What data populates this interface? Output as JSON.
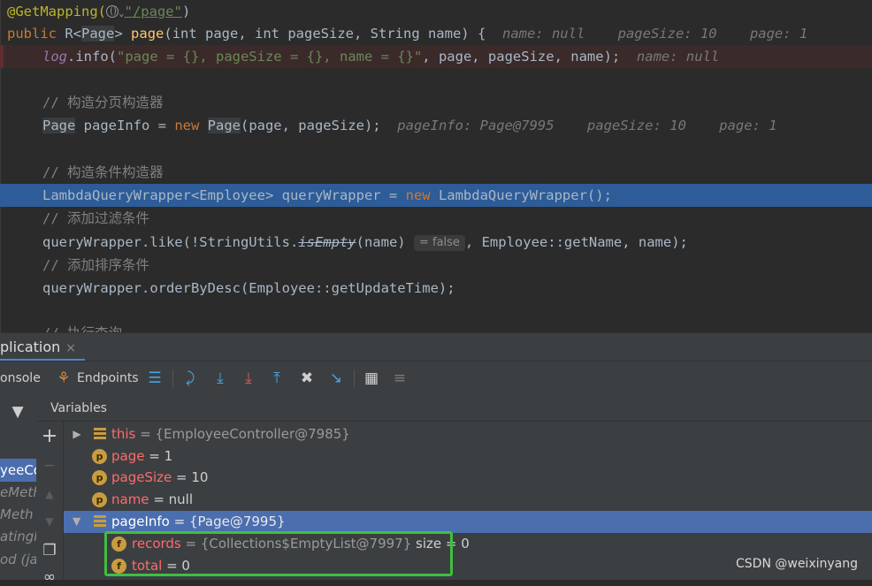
{
  "editor": {
    "lines": [
      {
        "kind": "annotation",
        "annotation": "@GetMapping(",
        "path": "\"/page\"",
        "close": ")"
      },
      {
        "kind": "signature",
        "public": "public",
        "r": "R<",
        "page_type": "Page",
        "gt": ">",
        "method": "page",
        "params": "(int page, int pageSize, String name) {",
        "hints": "name: null    pageSize: 10    page: 1"
      },
      {
        "kind": "log",
        "log": "log",
        "call": ".info(",
        "fmt": "\"page = {}, pageSize = {}, name = {}\"",
        "rest": ", page, pageSize, name);",
        "hint": "name: null"
      },
      {
        "kind": "comment",
        "text": "// 构造分页构造器"
      },
      {
        "kind": "pageinfo",
        "type": "Page",
        "a": " pageInfo = ",
        "new": "new",
        "b": " ",
        "type2": "Page",
        "c": "(page, pageSize);",
        "hints": "pageInfo: Page@7995    pageSize: 10    page: 1"
      },
      {
        "kind": "comment",
        "text": "// 构造条件构造器"
      },
      {
        "kind": "current",
        "a": "LambdaQueryWrapper<Employee> queryWrapper = ",
        "new": "new",
        "b": " LambdaQueryWrapper();"
      },
      {
        "kind": "comment",
        "text": "// 添加过滤条件"
      },
      {
        "kind": "like",
        "a": "queryWrapper.like(!StringUtils.",
        "strike": "isEmpty",
        "b": "(name)",
        "inlay": "= false",
        "c": ", Employee::getName, name);"
      },
      {
        "kind": "comment",
        "text": "// 添加排序条件"
      },
      {
        "kind": "plain",
        "text": "queryWrapper.orderByDesc(Employee::getUpdateTime);"
      },
      {
        "kind": "comment",
        "text": "// 执行查询"
      }
    ]
  },
  "debug": {
    "tab_label": "plication",
    "close_glyph": "×",
    "console_label": "onsole",
    "endpoints_label": "Endpoints",
    "variables_header": "Variables",
    "frames": [
      "yeeCo",
      "eMeth",
      "Meth",
      "atingM",
      "od (ja"
    ],
    "variables": [
      {
        "name": "this",
        "value": "= {EmployeeController@7985}",
        "kind": "object",
        "expandable": true
      },
      {
        "name": "page",
        "value": "= 1",
        "kind": "param",
        "badge": "p"
      },
      {
        "name": "pageSize",
        "value": "= 10",
        "kind": "param",
        "badge": "p"
      },
      {
        "name": "name",
        "value": "= null",
        "kind": "param",
        "badge": "p"
      },
      {
        "name": "pageInfo",
        "value": "= {Page@7995}",
        "kind": "object",
        "expanded": true
      },
      {
        "name": "records",
        "value": "= {Collections$EmptyList@7997}",
        "extra": "size = 0",
        "kind": "field",
        "badge": "f"
      },
      {
        "name": "total",
        "value": "= 0",
        "kind": "field",
        "badge": "f"
      }
    ]
  },
  "watermark": "CSDN @weixinyang",
  "colors": {
    "selection": "#4b6eaf",
    "current_line": "#2d5c98",
    "highlight_box": "#3fbf3f"
  }
}
